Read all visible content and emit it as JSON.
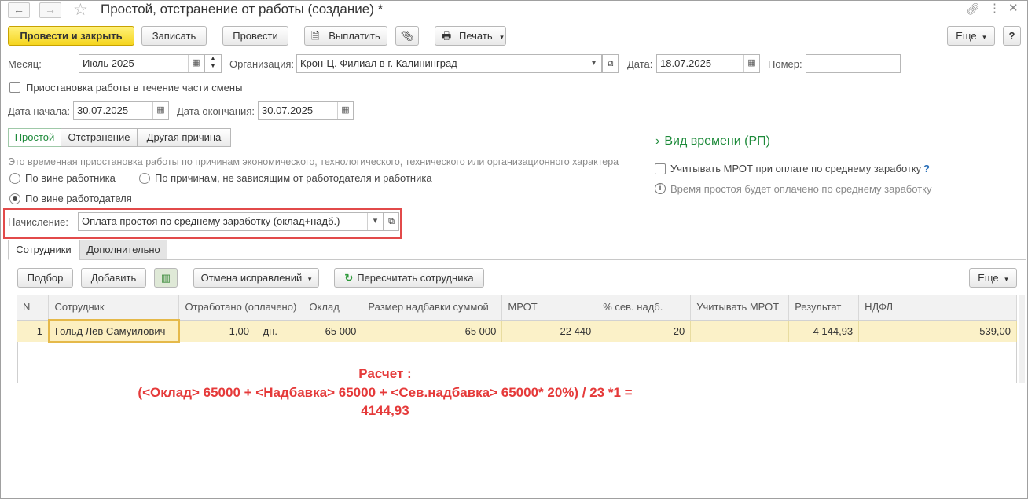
{
  "window": {
    "title": "Простой, отстранение от работы (создание) *"
  },
  "toolbar": {
    "post_close": "Провести и закрыть",
    "save": "Записать",
    "post": "Провести",
    "pay": "Выплатить",
    "print": "Печать",
    "more": "Еще",
    "help": "?"
  },
  "header": {
    "month_label": "Месяц:",
    "month_value": "Июль 2025",
    "org_label": "Организация:",
    "org_value": "Крон-Ц. Филиал в г. Калининград",
    "date_label": "Дата:",
    "date_value": "18.07.2025",
    "number_label": "Номер:",
    "number_value": ""
  },
  "partial_shift": {
    "label": "Приостановка работы в течение части смены",
    "checked": false
  },
  "period": {
    "start_label": "Дата начала:",
    "start_value": "30.07.2025",
    "end_label": "Дата окончания:",
    "end_value": "30.07.2025"
  },
  "kind_tabs": [
    "Простой",
    "Отстранение",
    "Другая причина"
  ],
  "description": "Это временная приостановка работы по причинам экономического, технологического, технического или организационного характера",
  "fault_options": {
    "employee": "По вине работника",
    "independent": "По причинам, не зависящим от работодателя и работника",
    "employer": "По вине работодателя",
    "selected": "employer"
  },
  "right_panel": {
    "time_type": "Вид времени (РП)",
    "consider_mrot": "Учитывать МРОТ при оплате по среднему заработку",
    "help_mark": "?",
    "info": "Время простоя будет оплачено по среднему заработку"
  },
  "accrual": {
    "label": "Начисление:",
    "value": "Оплата простоя по среднему заработку (оклад+надб.)"
  },
  "section_tabs": [
    "Сотрудники",
    "Дополнительно"
  ],
  "table_toolbar": {
    "pick": "Подбор",
    "add": "Добавить",
    "cancel_corrections": "Отмена исправлений",
    "recalc": "Пересчитать сотрудника",
    "more": "Еще"
  },
  "table": {
    "columns": [
      "N",
      "Сотрудник",
      "Отработано (оплачено)",
      "Оклад",
      "Размер надбавки суммой",
      "МРОТ",
      "% сев. надб.",
      "Учитывать МРОТ",
      "Результат",
      "НДФЛ"
    ],
    "rows": [
      {
        "n": "1",
        "employee": "Гольд Лев Самуилович",
        "worked": "1,00",
        "unit": "дн.",
        "salary": "65 000",
        "bonus": "65 000",
        "mrot": "22 440",
        "north_pct": "20",
        "consider_mrot": "",
        "result": "4 144,93",
        "ndfl": "539,00"
      }
    ]
  },
  "annotation": {
    "line1": "Расчет :",
    "line2": "(<Оклад> 65000 + <Надбавка> 65000 + <Сев.надбавка> 65000* 20%) / 23 *1 =",
    "line3": "4144,93"
  },
  "colors": {
    "accent_green": "#1d8a3a",
    "primary_yellow": "#f5d51f",
    "highlight_red": "#e53a3a",
    "row_yellow": "#fbf1c8"
  }
}
